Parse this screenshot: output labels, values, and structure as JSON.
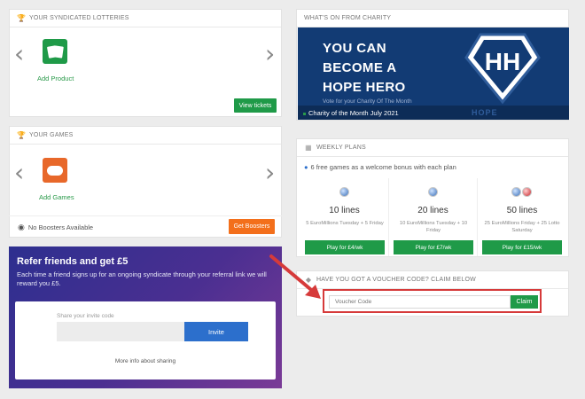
{
  "lotteries": {
    "header": "YOUR SYNDICATED LOTTERIES",
    "add_label": "Add Product",
    "view_button": "View tickets",
    "prev_arrow": "‹",
    "next_arrow": "›"
  },
  "games": {
    "header": "YOUR GAMES",
    "add_label": "Add Games",
    "boosters_text": "No Boosters Available",
    "boosters_button": "Get Boosters",
    "prev_arrow": "‹",
    "next_arrow": "›"
  },
  "refer": {
    "title": "Refer friends and get £5",
    "description": "Each time a friend signs up for an ongoing syndicate through your referral link we will reward you £5.",
    "code_label": "Share your invite code",
    "invite_button": "Invite",
    "more_info": "More info about sharing"
  },
  "charity": {
    "header": "WHAT'S ON FROM CHARITY",
    "headline_1": "YOU CAN",
    "headline_2": "BECOME A",
    "headline_3": "HOPE HERO",
    "vote_text": "Vote for your Charity Of The Month",
    "month_label": "Charity of the Month July 2021",
    "logo_word": "HOPE",
    "logo_letters": "HH"
  },
  "plans": {
    "header": "WEEKLY PLANS",
    "subtitle": "6 free games as a welcome bonus with each plan",
    "items": [
      {
        "lines": "10 lines",
        "desc": "5 EuroMillions Tuesday + 5 Friday",
        "button": "Play for £4/wk"
      },
      {
        "lines": "20 lines",
        "desc": "10 EuroMillions Tuesday + 10 Friday",
        "button": "Play for £7/wk"
      },
      {
        "lines": "50 lines",
        "desc": "25 EuroMillions Friday + 25 Lotto Saturday",
        "button": "Play for £15/wk"
      }
    ]
  },
  "voucher": {
    "header": "HAVE YOU GOT A VOUCHER CODE? CLAIM BELOW",
    "placeholder": "Voucher Code",
    "claim_button": "Claim"
  },
  "colors": {
    "green": "#1f9a48",
    "orange": "#f36f1b",
    "blue": "#2c6fcc",
    "highlight_red": "#d63a3a",
    "charity_navy": "#123b74"
  }
}
